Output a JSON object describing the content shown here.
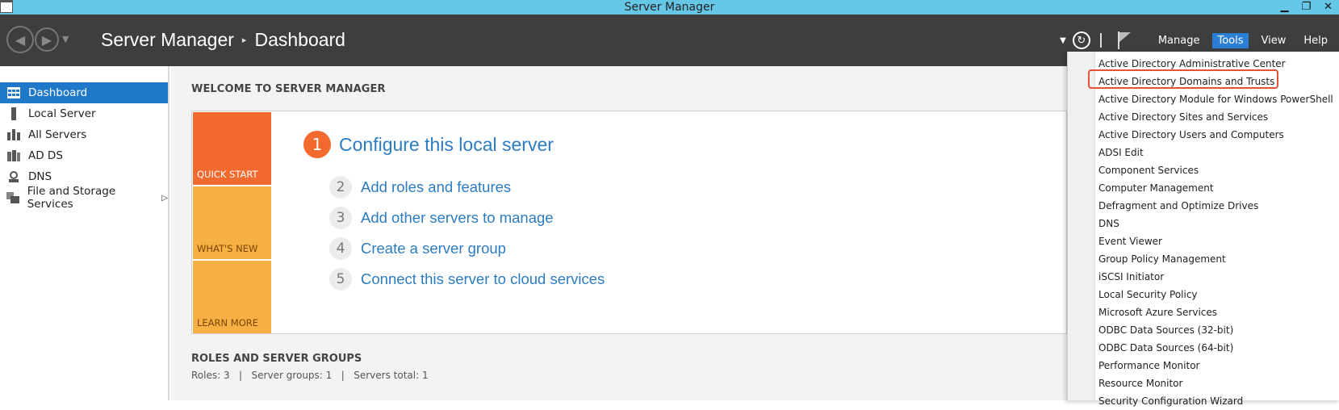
{
  "window": {
    "title": "Server Manager",
    "minimize": "▁",
    "restore": "❐",
    "close": "✕"
  },
  "header": {
    "breadcrumb_root": "Server Manager",
    "breadcrumb_sep": "▸",
    "breadcrumb_page": "Dashboard",
    "menus": {
      "manage": "Manage",
      "tools": "Tools",
      "view": "View",
      "help": "Help"
    }
  },
  "sidebar": {
    "items": [
      {
        "label": "Dashboard",
        "icon": "dashboard-icon"
      },
      {
        "label": "Local Server",
        "icon": "server-icon"
      },
      {
        "label": "All Servers",
        "icon": "servers-icon"
      },
      {
        "label": "AD DS",
        "icon": "ad-ds-icon"
      },
      {
        "label": "DNS",
        "icon": "dns-icon"
      },
      {
        "label": "File and Storage Services",
        "icon": "file-storage-icon"
      }
    ]
  },
  "main": {
    "welcome_title": "WELCOME TO SERVER MANAGER",
    "tiles": {
      "quick_start": "QUICK START",
      "whats_new": "WHAT'S NEW",
      "learn_more": "LEARN MORE"
    },
    "steps": [
      {
        "num": "1",
        "label": "Configure this local server"
      },
      {
        "num": "2",
        "label": "Add roles and features"
      },
      {
        "num": "3",
        "label": "Add other servers to manage"
      },
      {
        "num": "4",
        "label": "Create a server group"
      },
      {
        "num": "5",
        "label": "Connect this server to cloud services"
      }
    ],
    "roles_title": "ROLES AND SERVER GROUPS",
    "roles_stats": "Roles: 3   |   Server groups: 1   |   Servers total: 1"
  },
  "tools_menu": {
    "items": [
      "Active Directory Administrative Center",
      "Active Directory Domains and Trusts",
      "Active Directory Module for Windows PowerShell",
      "Active Directory Sites and Services",
      "Active Directory Users and Computers",
      "ADSI Edit",
      "Component Services",
      "Computer Management",
      "Defragment and Optimize Drives",
      "DNS",
      "Event Viewer",
      "Group Policy Management",
      "iSCSI Initiator",
      "Local Security Policy",
      "Microsoft Azure Services",
      "ODBC Data Sources (32-bit)",
      "ODBC Data Sources (64-bit)",
      "Performance Monitor",
      "Resource Monitor",
      "Security Configuration Wizard"
    ],
    "highlighted": "Active Directory Domains and Trusts"
  },
  "colors": {
    "accent": "#1f78c8",
    "orange": "#f26a2d",
    "amber": "#f7b043",
    "titlebar": "#66c6e6",
    "header": "#3e3e3e",
    "highlight": "#e5523a"
  }
}
